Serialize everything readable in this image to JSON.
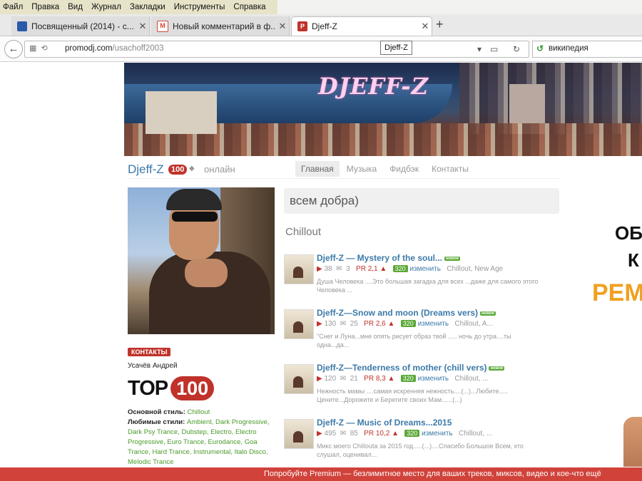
{
  "menu": [
    "Файл",
    "Правка",
    "Вид",
    "Журнал",
    "Закладки",
    "Инструменты",
    "Справка"
  ],
  "tabs": [
    {
      "label": "Посвященный (2014) - с...",
      "icon": "film-icon",
      "color": "#2a5aa8"
    },
    {
      "label": "Новый комментарий в ф...",
      "icon": "gmail-icon",
      "color": "#d44638"
    },
    {
      "label": "Djeff-Z",
      "icon": "promodj-icon",
      "color": "#c0322a"
    }
  ],
  "url": {
    "host": "promodj.com",
    "path": "/usachoff2003",
    "tooltip": "Djeff-Z"
  },
  "search": {
    "label": "википедия"
  },
  "banner": {
    "title": "DJEFF-Z"
  },
  "profile": {
    "name": "Djeff-Z",
    "rank": "100",
    "online": "онлайн",
    "tabs": [
      "Главная",
      "Музыка",
      "Фидбэк",
      "Контакты"
    ],
    "contacts_label": "КОНТАКТЫ",
    "real_name": "Усачёв Андрей",
    "top_label": "TOP",
    "top_num": "100",
    "main_style_label": "Основной стиль:",
    "main_style": "Chillout",
    "fav_styles_label": "Любимые стили:",
    "fav_styles": "Ambient, Dark Progressive, Dark Psy Trance, Dubstep, Electro, Electro Progressive, Euro Trance, Eurodance, Goa Trance, Hard Trance, Instrumental, Italo Disco, Melodic Trance"
  },
  "status": "всем добра)",
  "section": "Chillout",
  "tracks": [
    {
      "title": "Djeff-Z — Mystery of the soul...",
      "new": "новое",
      "plays": "38",
      "comments": "3",
      "pr": "PR 2,1 ▲",
      "kbps": "320",
      "change": "изменить",
      "genre": "Chillout, New Age",
      "desc": "Душа Человека ....Это большая загадка для всех ...даже для самого этого Человека ..."
    },
    {
      "title": "Djeff-Z—Snow and moon (Dreams vers)",
      "new": "новое",
      "plays": "130",
      "comments": "25",
      "pr": "PR 2,6 ▲",
      "kbps": "320",
      "change": "изменить",
      "genre": "Chillout, A...",
      "desc": "\"Снег и Луна...мне опять рисует образ твой ..... ночь до утра....ты одна...да..."
    },
    {
      "title": "Djeff-Z—Tenderness of mother (chill vers)",
      "new": "новое",
      "plays": "120",
      "comments": "21",
      "pr": "PR 8,3 ▲",
      "kbps": "320",
      "change": "изменить",
      "genre": "Chillout, ...",
      "desc": "Нежность мамы ....самая искренняя нежность....(...)...Любите..... Цените...Дорожите и Берегите своих Мам......(...)"
    },
    {
      "title": "Djeff-Z — Music of Dreams...2015",
      "new": "",
      "plays": "495",
      "comments": "85",
      "pr": "PR 10,2 ▲",
      "kbps": "320",
      "change": "изменить",
      "genre": "Chillout, ...",
      "desc": "Микс моего Chillouta за 2015 год.....(...)....Спасибо Большое Всем, кто слушал, оценивал..."
    }
  ],
  "ad": {
    "line1": "ОБ",
    "line2": "К",
    "line3": "РЕМ"
  },
  "premium": "Попробуйте Premium — безлимитное место для ваших треков, миксов, видео и кое-что ещё"
}
